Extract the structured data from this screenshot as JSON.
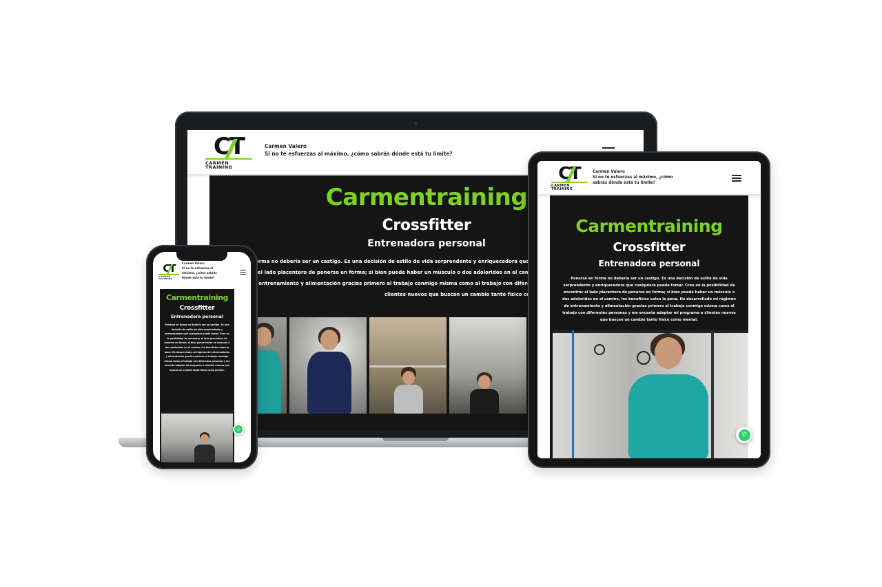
{
  "brand": {
    "logo_mark": "CT",
    "logo_word": "CARMEN TRAINING",
    "name": "Carmen Valero",
    "tagline": "Si no te esfuerzas al máximo, ¿cómo sabrás dónde está tu límite?",
    "accent_color": "#7ed321",
    "dark_color": "#151515"
  },
  "hero": {
    "title": "Carmentraining",
    "subtitle": "Crossfitter",
    "role": "Entrenadora personal",
    "body": "Ponerse en forma no debería ser un castigo. Es una decisión de estilo de vida sorprendente y enriquecedora que cualquiera puede tomar. Creo en la posibilidad de encontrar el lado placentero de ponerse en forma; si bien puede haber un músculo o dos adoloridos en el camino, los beneficios valen la pena. He desarrollado mi régimen de entrenamiento y alimentación gracias primero al trabajo conmigo misma como al trabajo con diferentes personas y me encanta adaptar mi programa a clientes nuevos que buscan un cambio tanto físico como mental."
  },
  "laptop": {
    "body_lines": [
      "forma no debería ser un castigo. Es una decisión de estilo de vida sorprendente y enriquecedora que cualquiera puede tomar.",
      "r el lado placentero de ponerse en forma; si bien puede haber un músculo o dos adoloridos en el camino, los beneficios valen",
      "o entrenamiento y alimentación gracias primero al trabajo conmigo misma como al trabajo con diferentes personas y me en",
      "clientes nuevos que buscan un cambio tanto físico como mental."
    ]
  },
  "icons": {
    "menu": "hamburger-menu-icon",
    "whatsapp": "whatsapp-icon"
  }
}
